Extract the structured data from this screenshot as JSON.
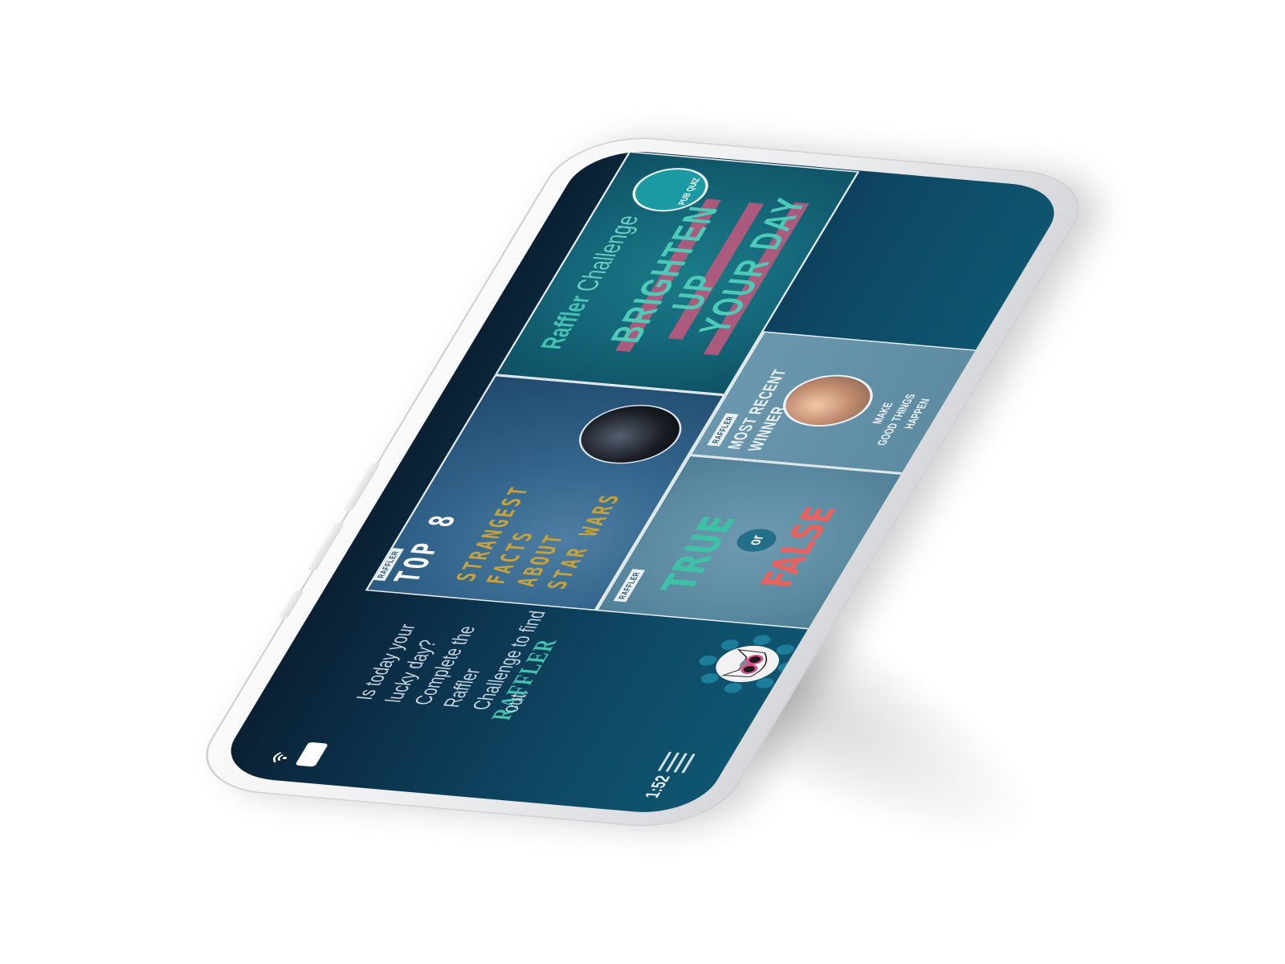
{
  "status_bar": {
    "time": "1:52"
  },
  "header": {
    "brand": "RAFFLER"
  },
  "intro": {
    "text": "Is today your lucky day? Complete the Raffler Challenge to find out."
  },
  "tiles": {
    "top8": {
      "tag": "RAFFLER",
      "title": "TOP 8",
      "lines": [
        "STRANGEST",
        "FACTS",
        "ABOUT",
        "STAR WARS"
      ]
    },
    "true_or_false": {
      "tag": "RAFFLER",
      "true_word": "TRUE",
      "or_word": "or",
      "false_word": "FALSE"
    },
    "winner": {
      "tag": "RAFFLER",
      "title": "MOST RECENT WINNER",
      "line1": "MAKE",
      "line2": "GOOD THINGS",
      "line3": "HAPPEN"
    },
    "challenge": {
      "title_bold": "Raffler",
      "title_light": "Challenge",
      "line1": "BRIGHTEN",
      "line2": "UP",
      "line3": "YOUR DAY",
      "badge": "PUB QUIZ"
    }
  },
  "colors": {
    "brand_teal": "#48c2b0",
    "screen_dark": "#0a2033",
    "screen_mid": "#0e4a66",
    "true_green": "#3ec2a6",
    "false_red": "#e8635f",
    "stripe_pink": "#b45a7c",
    "device_white": "#f2f2f4"
  },
  "icons": {
    "menu": "hamburger-menu-icon",
    "wifi": "wifi-icon",
    "battery": "battery-icon",
    "avatar": "cat-avatar-icon"
  }
}
